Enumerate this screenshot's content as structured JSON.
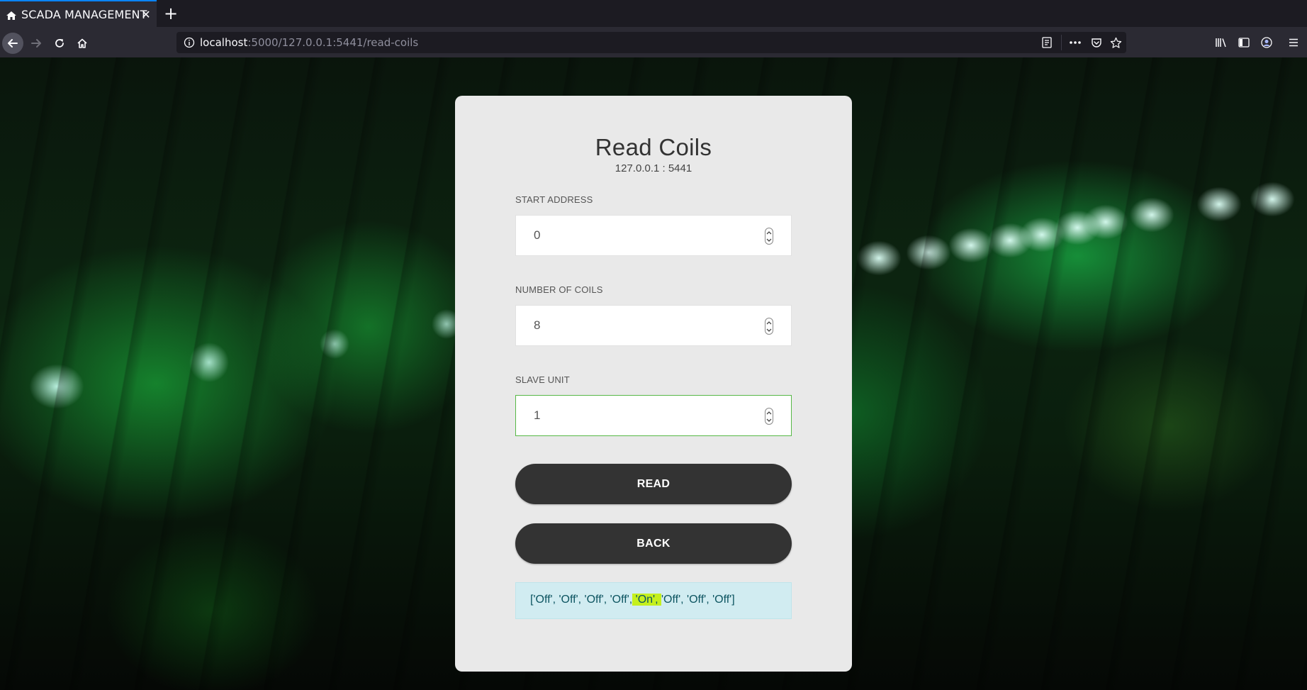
{
  "browser": {
    "tab": {
      "title": "SCADA MANAGEMENT",
      "close": "✕"
    },
    "new_tab": "+",
    "url": {
      "host": "localhost",
      "rest": ":5000/127.0.0.1:5441/read-coils"
    },
    "icons": [
      "back-icon",
      "forward-icon",
      "reload-icon",
      "home-icon",
      "info-icon",
      "reader-icon",
      "more-icon",
      "pocket-icon",
      "star-icon",
      "library-icon",
      "sidebar-icon",
      "account-icon",
      "menu-icon"
    ],
    "accent": "#0a84ff"
  },
  "card": {
    "title": "Read Coils",
    "subtitle": "127.0.0.1 : 5441",
    "fields": [
      {
        "label": "START ADDRESS",
        "value": "0"
      },
      {
        "label": "NUMBER OF COILS",
        "value": "8"
      },
      {
        "label": "SLAVE UNIT",
        "value": "1"
      }
    ],
    "read_button": "READ",
    "back_button": "BACK",
    "result": {
      "before": "['Off', 'Off', 'Off', 'Off',",
      "highlight": " 'On', ",
      "after": "'Off', 'Off', 'Off']"
    },
    "colors": {
      "focus_border": "#57b846",
      "button": "#333333",
      "result_bg": "#d1ecf1",
      "highlight": "#c5f01e"
    }
  }
}
